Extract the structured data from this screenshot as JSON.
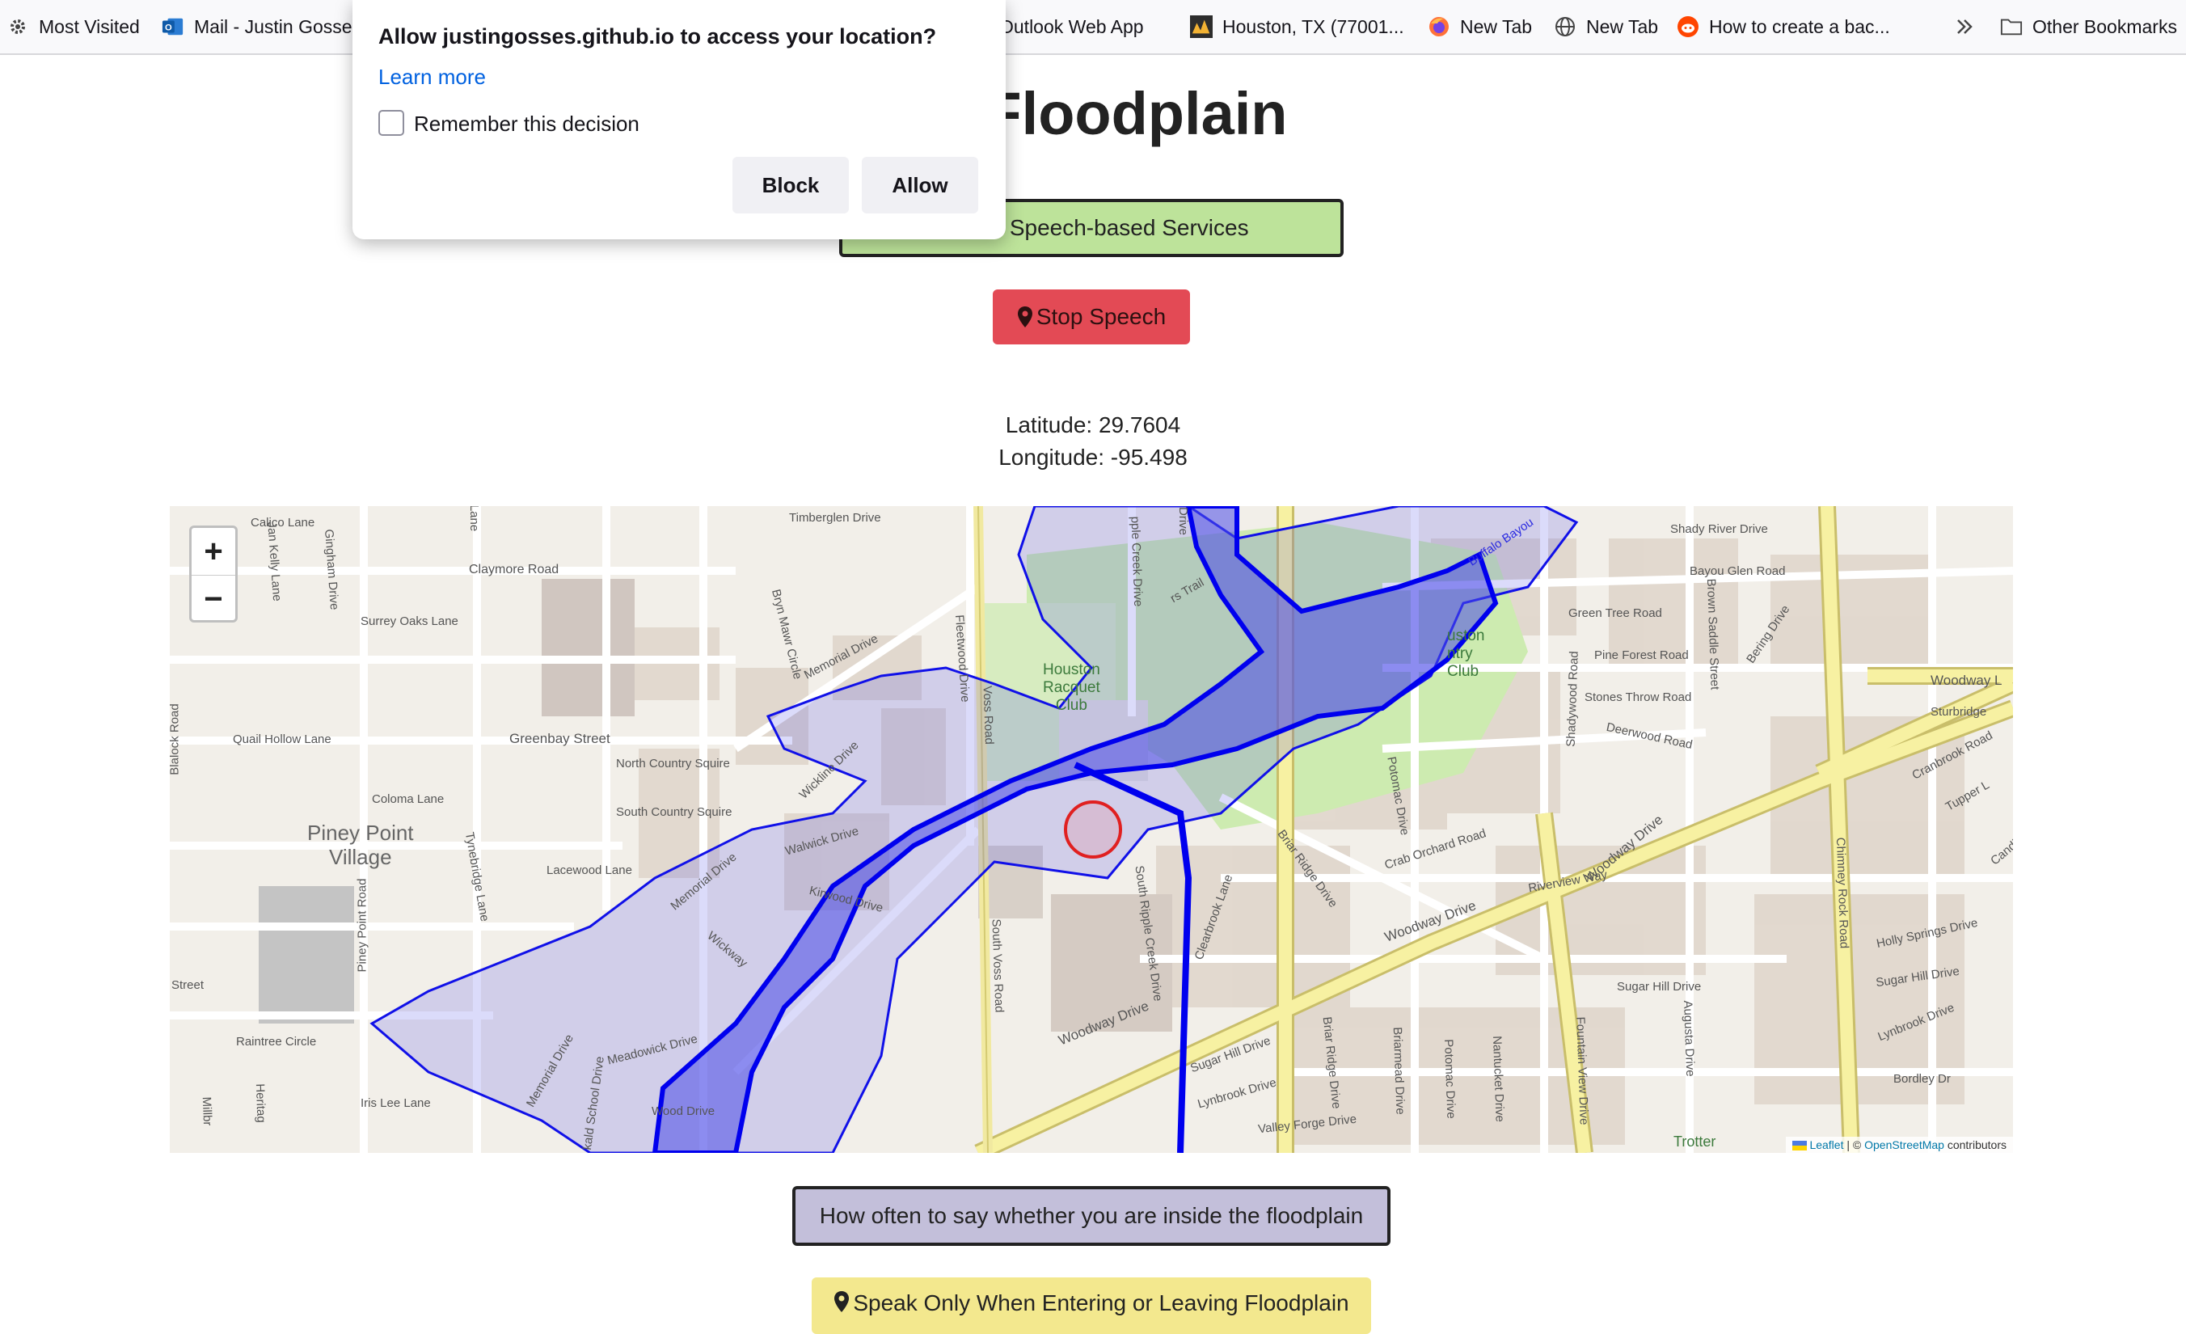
{
  "bookmarks": {
    "items": [
      {
        "label": "Most Visited"
      },
      {
        "label": "Mail - Justin Gosse"
      },
      {
        "label": "Outlook Web App"
      },
      {
        "label": "Houston, TX (77001..."
      },
      {
        "label": "New Tab"
      },
      {
        "label": "New Tab"
      },
      {
        "label": "How to create a bac..."
      }
    ],
    "other": "Other Bookmarks"
  },
  "page": {
    "title": "en Floodplain",
    "start_button": "on and Speech-based Services",
    "stop_button": "Stop Speech",
    "latitude": "Latitude: 29.7604",
    "longitude": "Longitude: -95.498",
    "frequency_button": "How often to say whether you are inside the floodplain",
    "speak_button": "Speak Only When Entering or Leaving Floodplain"
  },
  "map": {
    "zoom_in": "+",
    "zoom_out": "−",
    "attribution": {
      "leaflet": "Leaflet",
      "separator": " | © ",
      "osm": "OpenStreetMap",
      "suffix": " contributors"
    },
    "labels": {
      "calico": "Calico Lane",
      "claymore": "Claymore Road",
      "surrey": "Surrey Oaks Lane",
      "timberglen": "Timberglen Drive",
      "memorial1": "Memorial Drive",
      "quail": "Quail Hollow Lane",
      "greenbay": "Greenbay Street",
      "northcountry": "North Country Squire",
      "southcountry": "South Country Squire",
      "coloma": "Coloma Lane",
      "piney": "Piney Point\nVillage",
      "lacewood": "Lacewood Lane",
      "raintree": "Raintree Circle",
      "irislee": "Iris Lee Lane",
      "street": "Street",
      "racquet": "Houston\nRacquet\nClub",
      "country": "uston\nntry\nClub",
      "buffalo": "Buffalo Bayou",
      "shadyriver": "Shady River Drive",
      "bayouglen": "Bayou Glen Road",
      "greentree": "Green Tree Road",
      "pineforest": "Pine Forest Road",
      "stones": "Stones Throw Road",
      "deerwood": "Deerwood Road",
      "woodway1": "Woodway L",
      "woodway2": "Woodway Drive",
      "woodway3": "Woodway Drive",
      "woodway4": "Woodway Drive",
      "craborchard": "Crab Orchard Road",
      "riverview": "Riverview Way",
      "sugarhill": "Sugar Hill Drive",
      "sugarhill2": "Sugar Hill Drive",
      "sugarhill3": "Sugar Hill Drive",
      "hollysprings": "Holly Springs Drive",
      "valleyforge": "Valley Forge Drive",
      "lynbrook": "Lynbrook Drive",
      "lynbrook2": "Lynbrook Drive",
      "bordley": "Bordley Dr",
      "meadowick": "Meadowick Drive",
      "walwick": "Walwick Drive",
      "kirwood": "Kirwood Drive",
      "sturbridge": "Sturbridge",
      "cranbrook": "Cranbrook Road",
      "tupper": "Tupper L",
      "ryanwood": "Wood Drive",
      "trotter": "Trotter",
      "blalock": "Blalock Road",
      "pineypointrd": "Piney Point Road",
      "tynebridge": "Tynebridge Lane",
      "voss": "Voss Road",
      "southvoss": "South Voss Road",
      "chimney": "Chimney Rock Road",
      "fountain": "Fountain View Drive",
      "augusta": "Augusta Drive",
      "potomac": "Potomac Drive",
      "potomac2": "Potomac Drive",
      "nantucket": "Nantucket Drive",
      "briarmead": "Briarmead Drive",
      "briarridge": "Briar Ridge Drive",
      "briarridge2": "Briar Ridge Drive",
      "clearbrook": "Clearbrook Lane",
      "southripple": "South Ripple Creek Drive",
      "ripplecreek": "pple Creek Drive",
      "brynmawr": "Bryn Mawr Circle",
      "fleetwood": "Fleetwood Drive",
      "gingham": "Gingham Drive",
      "jankelly": "Jan Kelly Lane",
      "brownsaddle": "Brown Saddle Street",
      "shadywood": "Shadywood Road",
      "bering": "Bering Drive",
      "memorial2": "Memorial Drive",
      "memorial3": "Memorial Drive",
      "wickway": "Wickway",
      "candle": "Candl",
      "heritage": "Heritag",
      "millbro": "Millbr",
      "kaldschool": "kald School Drive",
      "lane": "Lane",
      "drive": "Drive",
      "trail": "rs Trail",
      "fieldgate": "Wickline Drive"
    }
  },
  "popup": {
    "question": "Allow justingosses.github.io to access your location?",
    "learn_more": "Learn more",
    "remember": "Remember this decision",
    "block": "Block",
    "allow": "Allow"
  }
}
